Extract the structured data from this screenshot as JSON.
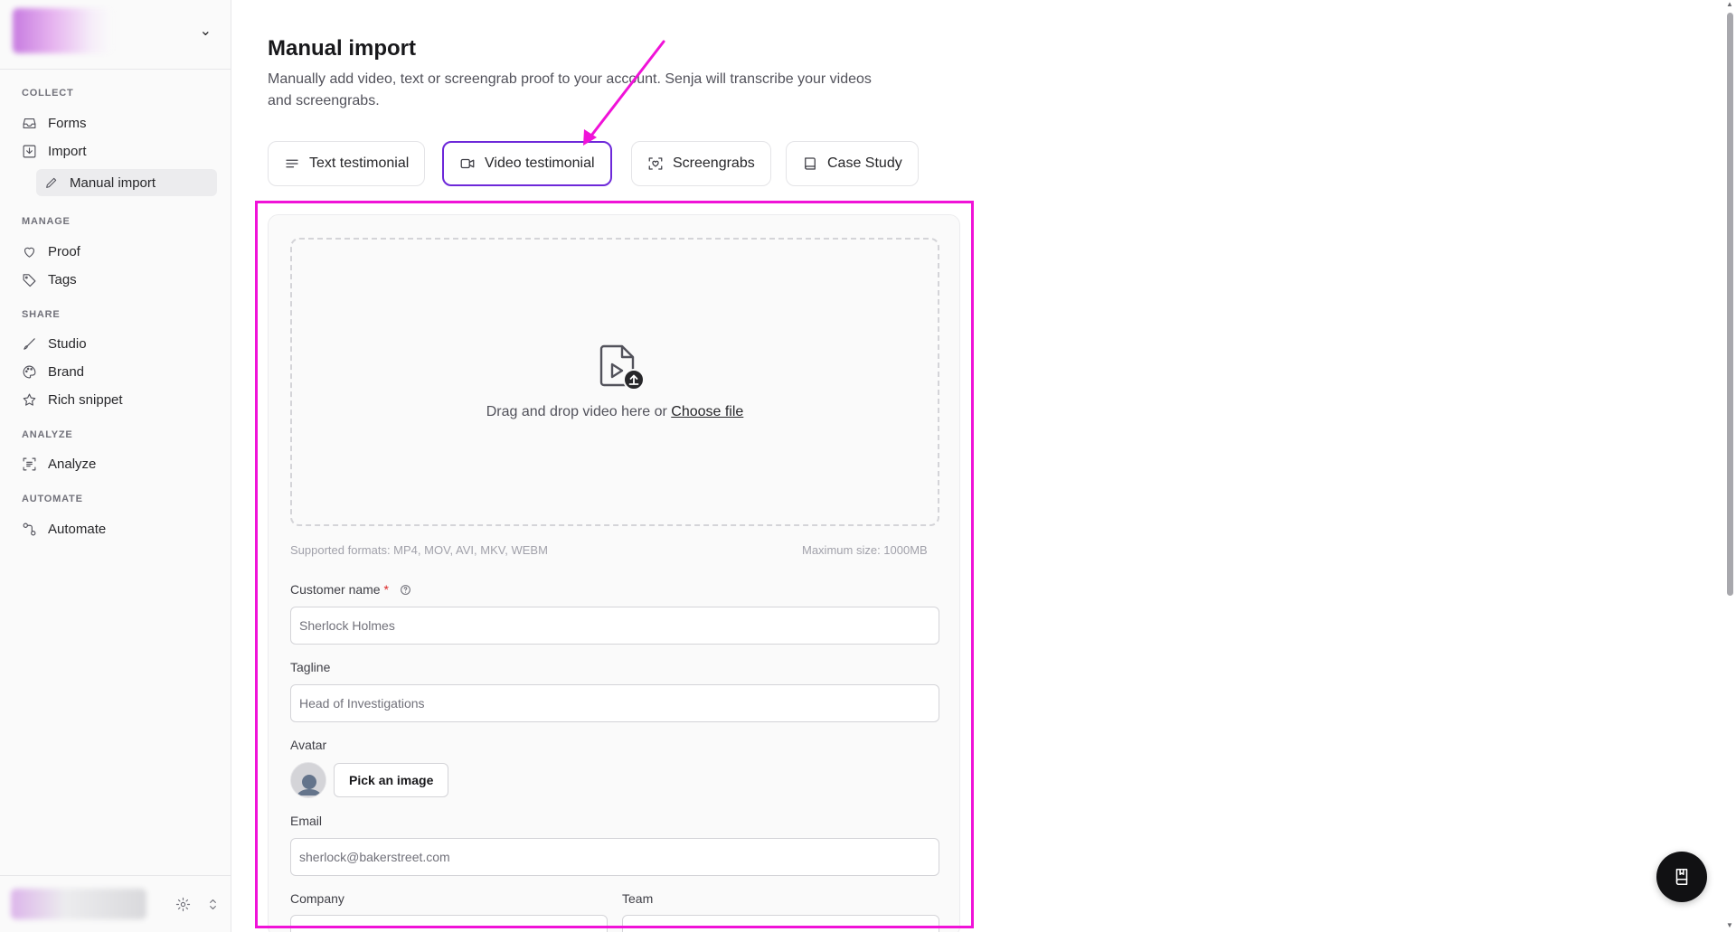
{
  "sidebar": {
    "sections": {
      "collect": "COLLECT",
      "manage": "MANAGE",
      "share": "SHARE",
      "analyze": "ANALYZE",
      "automate": "AUTOMATE"
    },
    "items": {
      "forms": "Forms",
      "import": "Import",
      "manual_import": "Manual import",
      "proof": "Proof",
      "tags": "Tags",
      "studio": "Studio",
      "brand": "Brand",
      "rich_snippet": "Rich snippet",
      "analyze": "Analyze",
      "automate": "Automate"
    }
  },
  "main": {
    "title": "Manual import",
    "description": "Manually add video, text or screengrab proof to your account. Senja will transcribe your videos and screengrabs.",
    "tabs": [
      {
        "label": "Text testimonial",
        "icon": "text-lines-icon",
        "active": false
      },
      {
        "label": "Video testimonial",
        "icon": "video-camera-icon",
        "active": true
      },
      {
        "label": "Screengrabs",
        "icon": "screengrab-icon",
        "active": false
      },
      {
        "label": "Case Study",
        "icon": "book-icon",
        "active": false
      }
    ],
    "dropzone": {
      "text": "Drag and drop video here or ",
      "link": "Choose file"
    },
    "supported_formats": "Supported formats: MP4, MOV, AVI, MKV, WEBM",
    "max_size": "Maximum size: 1000MB",
    "fields": {
      "customer_name": {
        "label": "Customer name",
        "required": "*",
        "placeholder": "Sherlock Holmes"
      },
      "tagline": {
        "label": "Tagline",
        "placeholder": "Head of Investigations"
      },
      "avatar": {
        "label": "Avatar",
        "button": "Pick an image"
      },
      "email": {
        "label": "Email",
        "placeholder": "sherlock@bakerstreet.com"
      },
      "company": {
        "label": "Company"
      },
      "team": {
        "label": "Team"
      }
    }
  },
  "colors": {
    "accent": "#6d28d9",
    "annotation": "#f012d8"
  }
}
